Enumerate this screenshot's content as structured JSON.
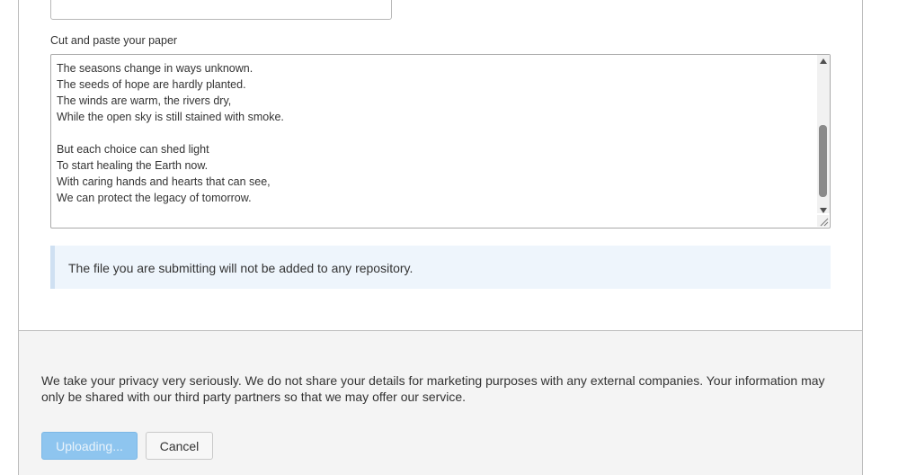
{
  "form": {
    "paste_label": "Cut and paste your paper",
    "paper_text": "The seasons change in ways unknown.\nThe seeds of hope are hardly planted.\nThe winds are warm, the rivers dry,\nWhile the open sky is still stained with smoke.\n\nBut each choice can shed light\nTo start healing the Earth now.\nWith caring hands and hearts that can see,\nWe can protect the legacy of tomorrow."
  },
  "notice": {
    "text": "The file you are submitting will not be added to any repository."
  },
  "footer": {
    "privacy_text": "We take your privacy very seriously. We do not share your details for marketing purposes with any external companies. Your information may only be shared with our third party partners so that we may offer our service.",
    "upload_button_label": "Uploading...",
    "cancel_button_label": "Cancel"
  },
  "colors": {
    "upload_button_bg": "#8ec5ef",
    "notice_bg": "#eef5fc",
    "footer_bg": "#f4f4f4"
  }
}
